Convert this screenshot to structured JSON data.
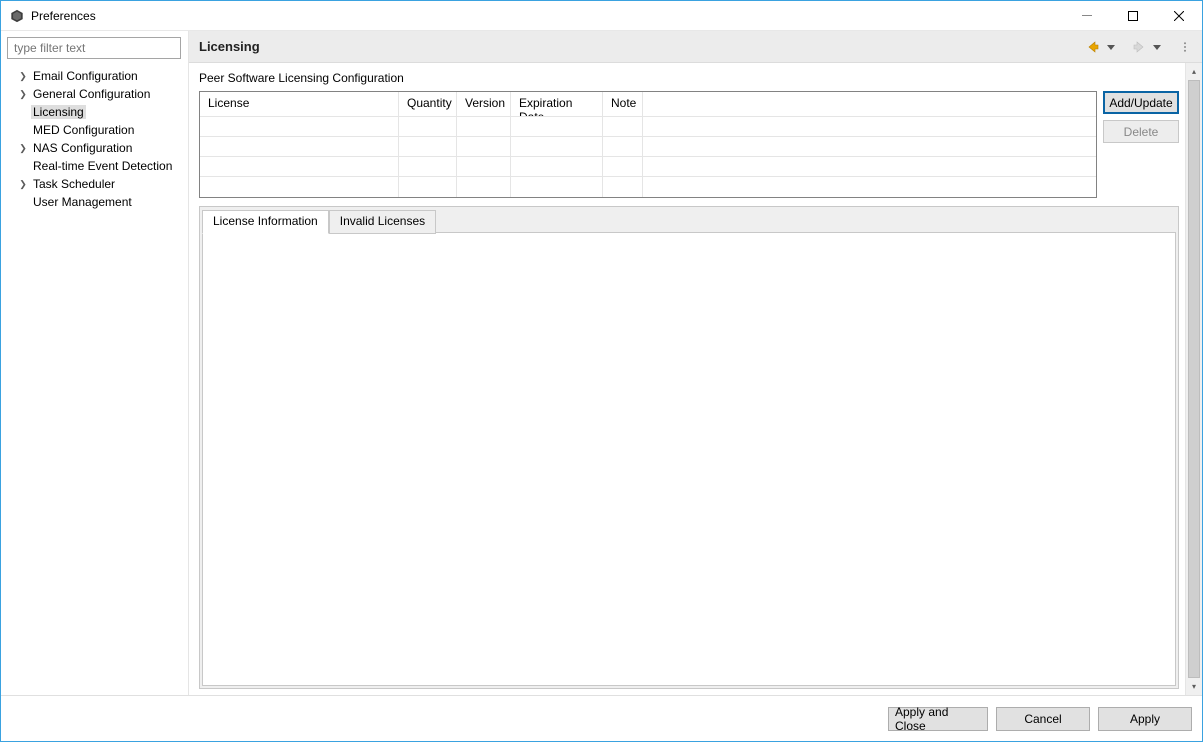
{
  "window": {
    "title": "Preferences"
  },
  "filter": {
    "placeholder": "type filter text"
  },
  "tree": {
    "items": [
      {
        "label": "Email Configuration",
        "expandable": true
      },
      {
        "label": "General Configuration",
        "expandable": true
      },
      {
        "label": "Licensing",
        "expandable": false,
        "selected": true
      },
      {
        "label": "MED Configuration",
        "expandable": false
      },
      {
        "label": "NAS Configuration",
        "expandable": true
      },
      {
        "label": "Real-time Event Detection",
        "expandable": false
      },
      {
        "label": "Task Scheduler",
        "expandable": true
      },
      {
        "label": "User Management",
        "expandable": false
      }
    ]
  },
  "page": {
    "title": "Licensing",
    "section_label": "Peer Software Licensing Configuration"
  },
  "table": {
    "columns": {
      "license": "License",
      "quantity": "Quantity",
      "version": "Version",
      "expiration": "Expiration Date",
      "note": "Note"
    },
    "rows": [
      {},
      {},
      {},
      {}
    ]
  },
  "buttons": {
    "add_update": "Add/Update",
    "delete": "Delete"
  },
  "tabs": {
    "info": "License Information",
    "invalid": "Invalid Licenses"
  },
  "footer": {
    "apply_close": "Apply and Close",
    "cancel": "Cancel",
    "apply": "Apply"
  }
}
